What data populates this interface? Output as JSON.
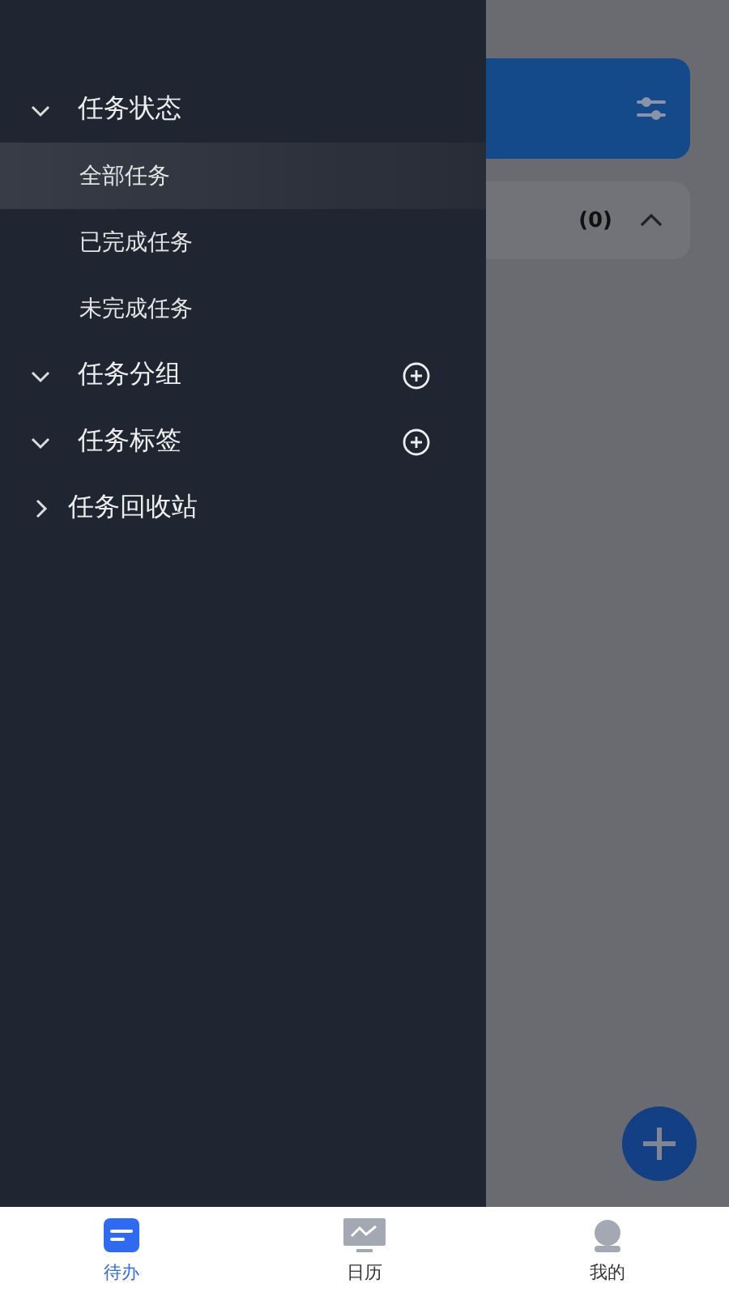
{
  "background": {
    "count": "(0)"
  },
  "drawer": {
    "sections": [
      {
        "label": "任务状态",
        "expanded": true,
        "addable": false,
        "children": [
          {
            "label": "全部任务",
            "selected": true
          },
          {
            "label": "已完成任务",
            "selected": false
          },
          {
            "label": "未完成任务",
            "selected": false
          }
        ]
      },
      {
        "label": "任务分组",
        "expanded": true,
        "addable": true
      },
      {
        "label": "任务标签",
        "expanded": true,
        "addable": true
      },
      {
        "label": "任务回收站",
        "expanded": false,
        "addable": false
      }
    ]
  },
  "tabs": [
    {
      "label": "待办",
      "selected": true
    },
    {
      "label": "日历",
      "selected": false
    },
    {
      "label": "我的",
      "selected": false
    }
  ]
}
